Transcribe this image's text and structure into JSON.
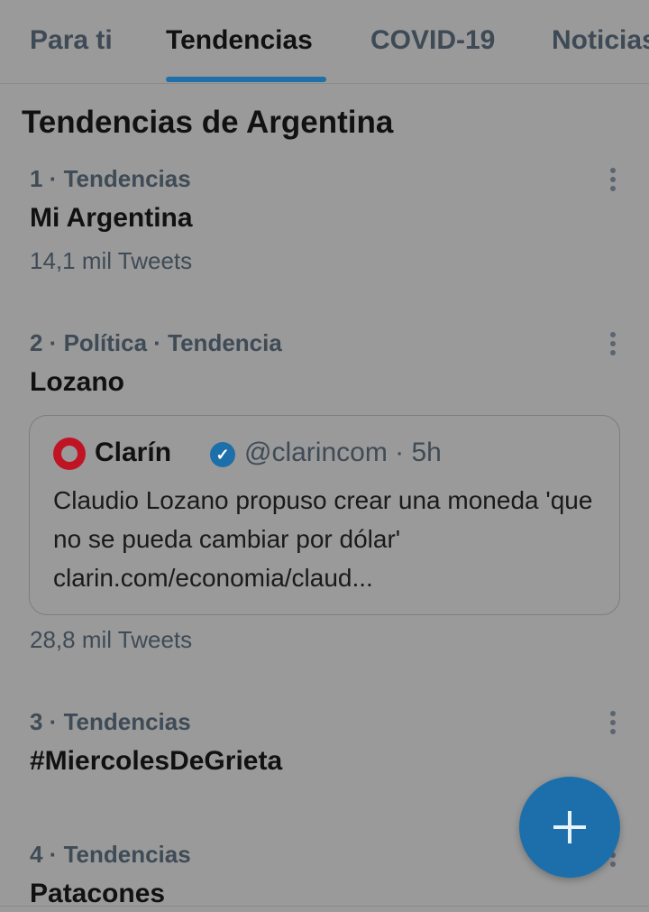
{
  "tabs": [
    {
      "label": "Para ti",
      "active": false
    },
    {
      "label": "Tendencias",
      "active": true
    },
    {
      "label": "COVID-19",
      "active": false
    },
    {
      "label": "Noticias",
      "active": false
    }
  ],
  "section_title": "Tendencias de Argentina",
  "trends": [
    {
      "meta": "1 · Tendencias",
      "name": "Mi Argentina",
      "count": "14,1 mil Tweets"
    },
    {
      "meta": "2 · Política · Tendencia",
      "name": "Lozano",
      "count": "28,8 mil Tweets",
      "tweet": {
        "author": "Clarín",
        "verified": true,
        "handle_time": "@clarincom · 5h",
        "text": "Claudio Lozano propuso crear una moneda 'que no se pueda cambiar por dólar' clarin.com/economia/claud..."
      }
    },
    {
      "meta": "3 · Tendencias",
      "name": "#MiercolesDeGrieta"
    },
    {
      "meta": "4 · Tendencias",
      "name": "Patacones"
    }
  ],
  "icons": {
    "more": "more-vertical-icon",
    "compose": "plus-icon",
    "verified": "verified-badge-icon",
    "logo": "clarin-logo"
  },
  "colors": {
    "accent": "#1d6fab",
    "background": "#9a9a9a"
  }
}
